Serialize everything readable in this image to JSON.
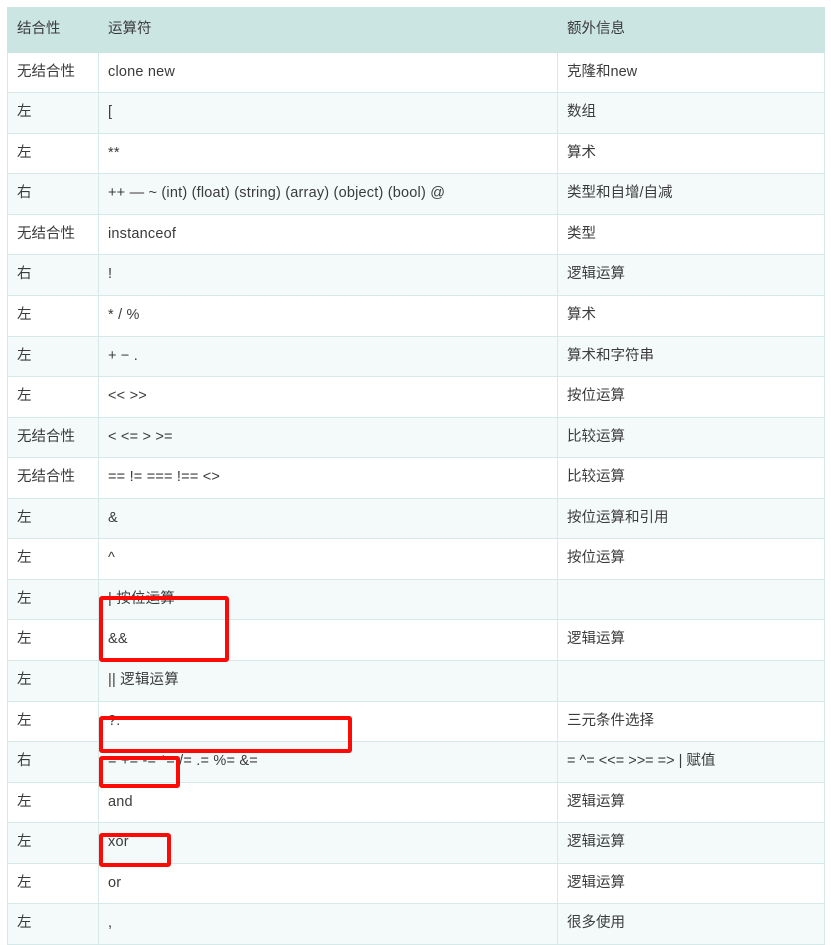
{
  "table": {
    "headers": [
      "结合性",
      "运算符",
      "额外信息"
    ],
    "rows": [
      {
        "assoc": "无结合性",
        "operator": "clone new",
        "info": "克隆和new"
      },
      {
        "assoc": "左",
        "operator": "[",
        "info": "数组"
      },
      {
        "assoc": "左",
        "operator": "**",
        "info": "算术"
      },
      {
        "assoc": "右",
        "operator": "++ — ~ (int) (float) (string) (array) (object) (bool) @",
        "info": "类型和自增/自减"
      },
      {
        "assoc": "无结合性",
        "operator": "instanceof",
        "info": "类型"
      },
      {
        "assoc": "右",
        "operator": "!",
        "info": "逻辑运算"
      },
      {
        "assoc": "左",
        "operator": "* / %",
        "info": "算术"
      },
      {
        "assoc": "左",
        "operator": "+ − .",
        "info": "算术和字符串"
      },
      {
        "assoc": "左",
        "operator": "<< >>",
        "info": "按位运算"
      },
      {
        "assoc": "无结合性",
        "operator": "< <= > >=",
        "info": "比较运算"
      },
      {
        "assoc": "无结合性",
        "operator": "== != === !== <>",
        "info": "比较运算"
      },
      {
        "assoc": "左",
        "operator": "&",
        "info": "按位运算和引用"
      },
      {
        "assoc": "左",
        "operator": "^",
        "info": "按位运算"
      },
      {
        "assoc": "左",
        "operator": "| 按位运算",
        "info": ""
      },
      {
        "assoc": "左",
        "operator": "&&",
        "info": "逻辑运算"
      },
      {
        "assoc": "左",
        "operator": "|| 逻辑运算",
        "info": ""
      },
      {
        "assoc": "左",
        "operator": "?:",
        "info": "三元条件选择"
      },
      {
        "assoc": "右",
        "operator": "= += -= *= /= .= %= &=",
        "info": "= ^= <<= >>= => | 赋值"
      },
      {
        "assoc": "左",
        "operator": "and",
        "info": "逻辑运算"
      },
      {
        "assoc": "左",
        "operator": "xor",
        "info": "逻辑运算"
      },
      {
        "assoc": "左",
        "operator": "or",
        "info": "逻辑运算"
      },
      {
        "assoc": "左",
        "operator": ",",
        "info": "很多使用"
      }
    ]
  },
  "annotations": {
    "color": "#fb0a06",
    "boxes": [
      {
        "name": "logical-and-or-highlight",
        "targets": [
          "&&",
          "|| 逻辑运算"
        ]
      },
      {
        "name": "assignment-operators-highlight",
        "targets": [
          "= += -= *= /= .= %= &="
        ]
      },
      {
        "name": "and-keyword-highlight",
        "targets": [
          "and"
        ]
      },
      {
        "name": "or-keyword-highlight",
        "targets": [
          "or"
        ]
      }
    ]
  },
  "theme": {
    "header_bg": "#cbe5e3",
    "row_alt_bg": "#f4fafa",
    "row_bg": "#ffffff",
    "border": "#d6e9e9",
    "text": "#3b3b3b"
  }
}
